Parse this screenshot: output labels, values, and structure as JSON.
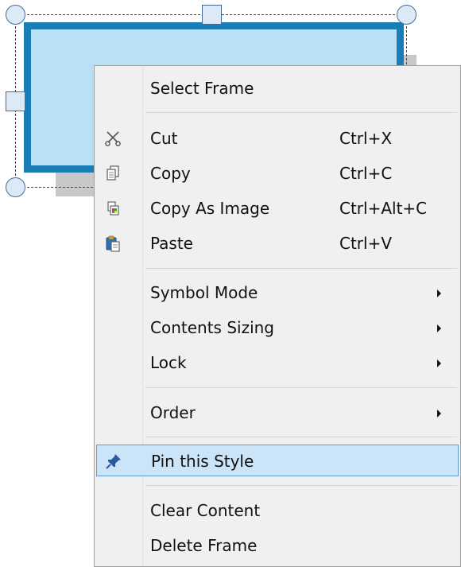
{
  "context_menu": {
    "items": [
      {
        "label": "Select Frame",
        "shortcut": "",
        "icon": "",
        "submenu": false
      },
      {
        "label": "Cut",
        "shortcut": "Ctrl+X",
        "icon": "scissors-icon",
        "submenu": false
      },
      {
        "label": "Copy",
        "shortcut": "Ctrl+C",
        "icon": "copy-icon",
        "submenu": false
      },
      {
        "label": "Copy As Image",
        "shortcut": "Ctrl+Alt+C",
        "icon": "copy-as-image-icon",
        "submenu": false
      },
      {
        "label": "Paste",
        "shortcut": "Ctrl+V",
        "icon": "paste-icon",
        "submenu": false
      },
      {
        "label": "Symbol Mode",
        "shortcut": "",
        "icon": "",
        "submenu": true
      },
      {
        "label": "Contents Sizing",
        "shortcut": "",
        "icon": "",
        "submenu": true
      },
      {
        "label": "Lock",
        "shortcut": "",
        "icon": "",
        "submenu": true
      },
      {
        "label": "Order",
        "shortcut": "",
        "icon": "",
        "submenu": true
      },
      {
        "label": "Pin this Style",
        "shortcut": "",
        "icon": "pin-icon",
        "submenu": false,
        "highlighted": true
      },
      {
        "label": "Clear Content",
        "shortcut": "",
        "icon": "",
        "submenu": false
      },
      {
        "label": "Delete Frame",
        "shortcut": "",
        "icon": "",
        "submenu": false
      }
    ]
  },
  "colors": {
    "frame_border": "#1b7db5",
    "frame_fill": "#b9e0f4",
    "menu_background": "#f0f0f0",
    "highlight_fill": "#cce4f7",
    "highlight_border": "#5c9bd6",
    "pin_icon": "#2a5a9a"
  }
}
